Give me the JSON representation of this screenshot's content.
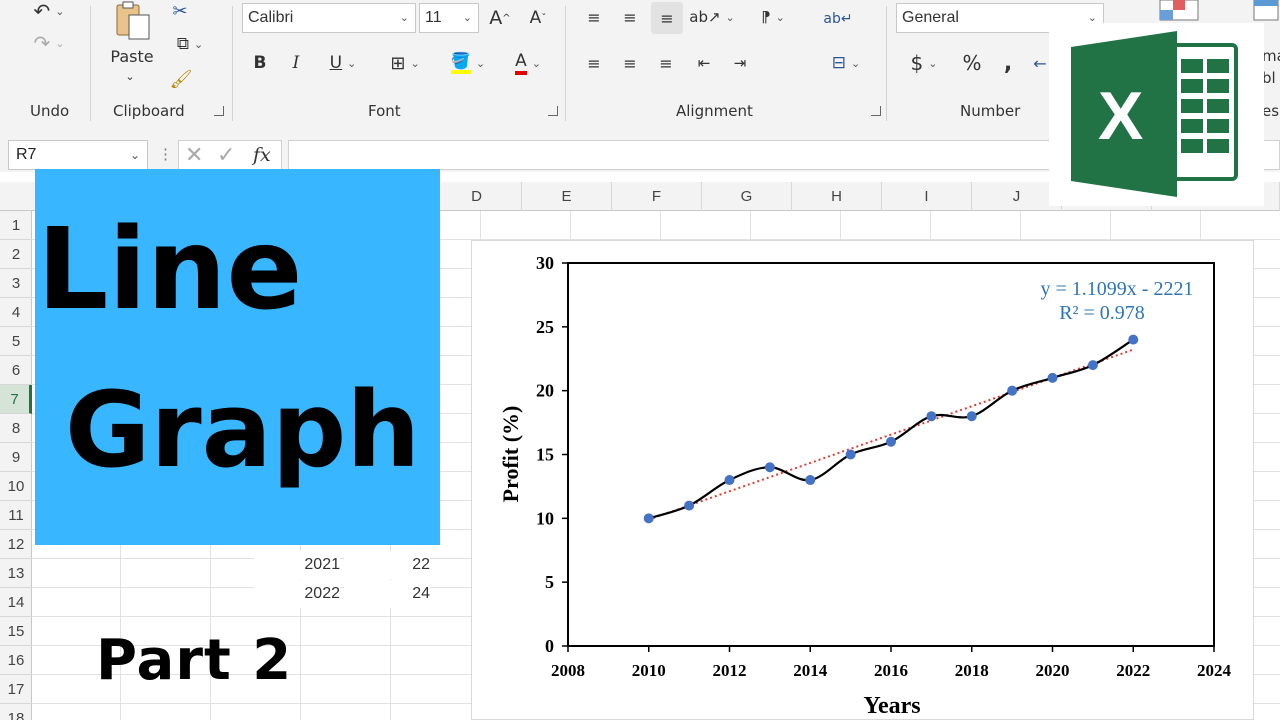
{
  "ribbon": {
    "undo_label": "Undo",
    "clipboard": {
      "label": "Clipboard",
      "paste_label": "Paste"
    },
    "font": {
      "label": "Font",
      "family": "Calibri",
      "size": "11"
    },
    "alignment": {
      "label": "Alignment"
    },
    "number": {
      "label": "Number",
      "format": "General"
    },
    "cut_text_1": "ma",
    "cut_text_2": "bl",
    "cut_text_3": "es"
  },
  "formula_bar": {
    "name_box": "R7",
    "formula": ""
  },
  "columns": [
    "D",
    "E",
    "F",
    "G",
    "H",
    "I",
    "J"
  ],
  "rows": [
    "1",
    "2",
    "3",
    "4",
    "5",
    "6",
    "7",
    "8",
    "9",
    "10",
    "11",
    "12",
    "13",
    "14",
    "15",
    "16",
    "17",
    "18"
  ],
  "active_row": "7",
  "visible_cells": [
    {
      "year": "2021",
      "value": "22"
    },
    {
      "year": "2022",
      "value": "24"
    }
  ],
  "overlay": {
    "title_line1": "Line",
    "title_line2": "Graph",
    "part": "Part 2"
  },
  "colors": {
    "title_box": "#38b6ff",
    "excel_green": "#217346",
    "data_points": "#4472c4",
    "trendline": "#e03c31",
    "equation_text": "#2e75b6"
  },
  "chart_data": {
    "type": "scatter",
    "title": "",
    "xlabel": "Years",
    "ylabel": "Profit (%)",
    "xlim": [
      2008,
      2024
    ],
    "ylim": [
      0,
      30
    ],
    "xticks": [
      2008,
      2010,
      2012,
      2014,
      2016,
      2018,
      2020,
      2022,
      2024
    ],
    "yticks": [
      0,
      5,
      10,
      15,
      20,
      25,
      30
    ],
    "series": [
      {
        "x": [
          2010,
          2011,
          2012,
          2013,
          2014,
          2015,
          2016,
          2017,
          2018,
          2019,
          2020,
          2021,
          2022
        ],
        "y": [
          10,
          11,
          13,
          14,
          13,
          15,
          16,
          18,
          18,
          20,
          21,
          22,
          24
        ],
        "line": "smoothed"
      }
    ],
    "trendline": {
      "type": "linear",
      "slope": 1.1099,
      "intercept": -2221,
      "style": "dotted"
    },
    "annotations": [
      "y = 1.1099x - 2221",
      "R² = 0.978"
    ],
    "grid": false,
    "legend": "none"
  }
}
